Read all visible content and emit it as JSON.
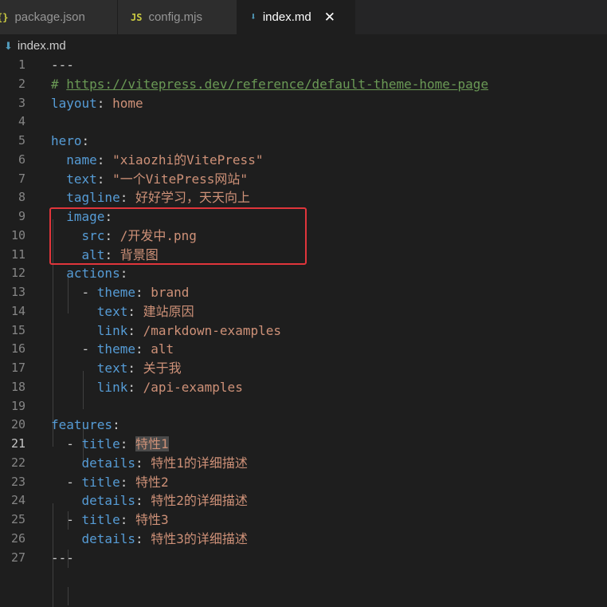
{
  "tabs": [
    {
      "icon": "{}",
      "label": "package.json",
      "active": false
    },
    {
      "icon": "JS",
      "label": "config.mjs",
      "active": false
    },
    {
      "icon": "⬇",
      "label": "index.md",
      "active": true
    }
  ],
  "breadcrumb": "index.md",
  "line_numbers": [
    "1",
    "2",
    "3",
    "4",
    "5",
    "6",
    "7",
    "8",
    "9",
    "10",
    "11",
    "12",
    "13",
    "14",
    "15",
    "16",
    "17",
    "18",
    "19",
    "20",
    "21",
    "22",
    "23",
    "24",
    "25",
    "26",
    "27"
  ],
  "code": {
    "l1": "---",
    "l2_hash": "# ",
    "l2_url": "https://vitepress.dev/reference/default-theme-home-page",
    "l3_key": "layout",
    "l3_val": "home",
    "l5_key": "hero",
    "l6_key": "name",
    "l6_val": "\"xiaozhi的VitePress\"",
    "l7_key": "text",
    "l7_val": "\"一个VitePress网站\"",
    "l8_key": "tagline",
    "l8_val": "好好学习，天天向上",
    "l9_key": "image",
    "l10_key": "src",
    "l10_val": "/开发中.png",
    "l11_key": "alt",
    "l11_val": "背景图",
    "l12_key": "actions",
    "l13_key": "theme",
    "l13_val": "brand",
    "l14_key": "text",
    "l14_val": "建站原因",
    "l15_key": "link",
    "l15_val": "/markdown-examples",
    "l16_key": "theme",
    "l16_val": "alt",
    "l17_key": "text",
    "l17_val": "关于我",
    "l18_key": "link",
    "l18_val": "/api-examples",
    "l20_key": "features",
    "l21_key": "title",
    "l21_val": "特性1",
    "l22_key": "details",
    "l22_val": "特性1的详细描述",
    "l23_key": "title",
    "l23_val": "特性2",
    "l24_key": "details",
    "l24_val": "特性2的详细描述",
    "l25_key": "title",
    "l25_val": "特性3",
    "l26_key": "details",
    "l26_val": "特性3的详细描述",
    "l27": "---"
  },
  "colors": {
    "key": "#569cd6",
    "string": "#ce9178",
    "comment": "#6a9955",
    "highlight_box": "#e0353b"
  }
}
